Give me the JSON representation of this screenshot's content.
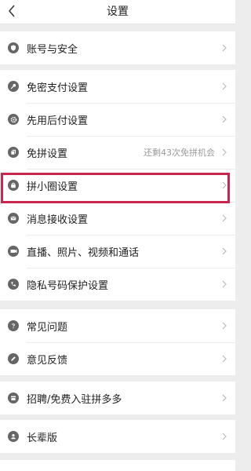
{
  "header": {
    "title": "设置",
    "back_icon": "chevron-left-icon"
  },
  "colors": {
    "background": "#ededed",
    "icon": "#666666",
    "highlight": "#c8264f",
    "hint_text": "#9a9a9a"
  },
  "groups": [
    {
      "items": [
        {
          "label": "账号与安全",
          "icon": "shield-icon"
        }
      ]
    },
    {
      "items": [
        {
          "label": "免密支付设置",
          "icon": "key-icon"
        },
        {
          "label": "先用后付设置",
          "icon": "gear-icon"
        },
        {
          "label": "免拼设置",
          "icon": "copy-icon",
          "extra": "还剩43次免拼机会"
        },
        {
          "label": "拼小圈设置",
          "icon": "bag-icon",
          "highlighted": true
        },
        {
          "label": "消息接收设置",
          "icon": "mail-icon"
        },
        {
          "label": "直播、照片、视频和通话",
          "icon": "video-icon"
        },
        {
          "label": "隐私号码保护设置",
          "icon": "phone-icon"
        }
      ]
    },
    {
      "items": [
        {
          "label": "常见问题",
          "icon": "question-icon"
        },
        {
          "label": "意见反馈",
          "icon": "edit-icon"
        }
      ]
    },
    {
      "items": [
        {
          "label": "招聘/免费入驻拼多多",
          "icon": "store-icon"
        }
      ]
    },
    {
      "items": [
        {
          "label": "长辈版",
          "icon": "person-icon"
        }
      ]
    }
  ]
}
